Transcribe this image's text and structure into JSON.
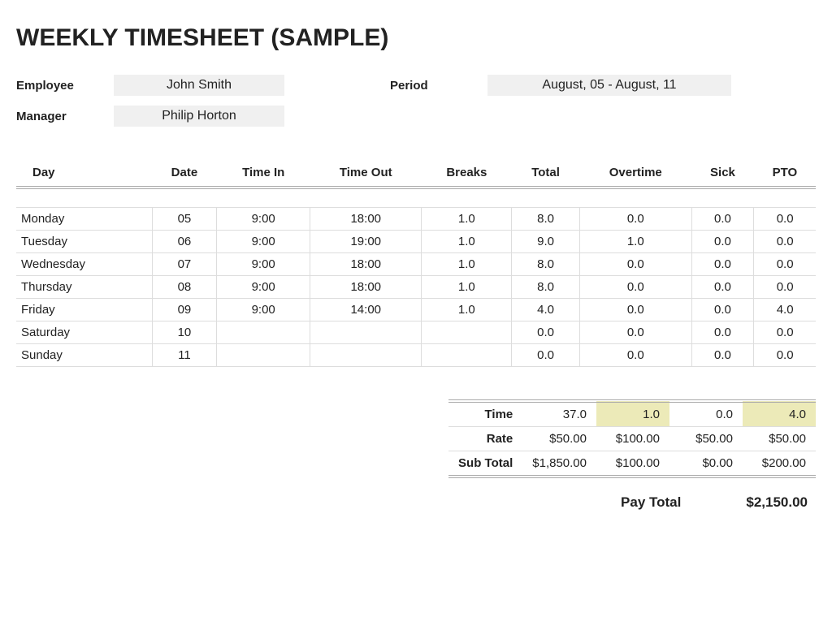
{
  "title": "WEEKLY TIMESHEET (SAMPLE)",
  "meta": {
    "employee_label": "Employee",
    "employee_value": "John Smith",
    "period_label": "Period",
    "period_value": "August, 05 - August, 11",
    "manager_label": "Manager",
    "manager_value": "Philip Horton"
  },
  "headers": {
    "day": "Day",
    "date": "Date",
    "time_in": "Time In",
    "time_out": "Time Out",
    "breaks": "Breaks",
    "total": "Total",
    "overtime": "Overtime",
    "sick": "Sick",
    "pto": "PTO"
  },
  "rows": [
    {
      "day": "Monday",
      "date": "05",
      "in": "9:00",
      "out": "18:00",
      "breaks": "1.0",
      "total": "8.0",
      "ot": "0.0",
      "sick": "0.0",
      "pto": "0.0"
    },
    {
      "day": "Tuesday",
      "date": "06",
      "in": "9:00",
      "out": "19:00",
      "breaks": "1.0",
      "total": "9.0",
      "ot": "1.0",
      "sick": "0.0",
      "pto": "0.0"
    },
    {
      "day": "Wednesday",
      "date": "07",
      "in": "9:00",
      "out": "18:00",
      "breaks": "1.0",
      "total": "8.0",
      "ot": "0.0",
      "sick": "0.0",
      "pto": "0.0"
    },
    {
      "day": "Thursday",
      "date": "08",
      "in": "9:00",
      "out": "18:00",
      "breaks": "1.0",
      "total": "8.0",
      "ot": "0.0",
      "sick": "0.0",
      "pto": "0.0"
    },
    {
      "day": "Friday",
      "date": "09",
      "in": "9:00",
      "out": "14:00",
      "breaks": "1.0",
      "total": "4.0",
      "ot": "0.0",
      "sick": "0.0",
      "pto": "4.0"
    },
    {
      "day": "Saturday",
      "date": "10",
      "in": "",
      "out": "",
      "breaks": "",
      "total": "0.0",
      "ot": "0.0",
      "sick": "0.0",
      "pto": "0.0"
    },
    {
      "day": "Sunday",
      "date": "11",
      "in": "",
      "out": "",
      "breaks": "",
      "total": "0.0",
      "ot": "0.0",
      "sick": "0.0",
      "pto": "0.0"
    }
  ],
  "summary": {
    "time_label": "Time",
    "rate_label": "Rate",
    "subtotal_label": "Sub Total",
    "time": {
      "total": "37.0",
      "ot": "1.0",
      "sick": "0.0",
      "pto": "4.0"
    },
    "rate": {
      "total": "$50.00",
      "ot": "$100.00",
      "sick": "$50.00",
      "pto": "$50.00"
    },
    "subtotal": {
      "total": "$1,850.00",
      "ot": "$100.00",
      "sick": "$0.00",
      "pto": "$200.00"
    }
  },
  "pay_total_label": "Pay Total",
  "pay_total_value": "$2,150.00"
}
